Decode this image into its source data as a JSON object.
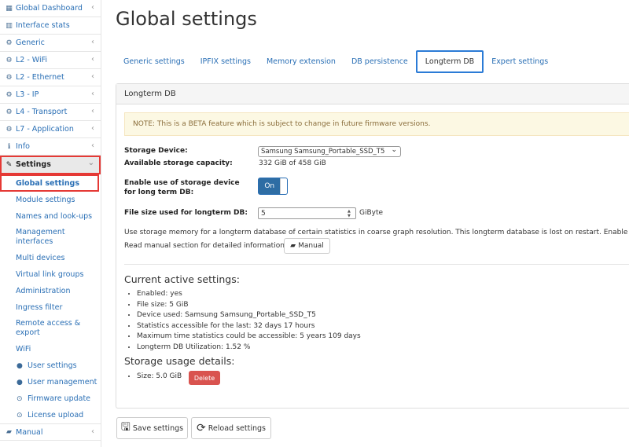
{
  "sidebar": {
    "items": [
      {
        "label": "Global Dashboard",
        "icon": "dashboard-icon",
        "chevron": "‹"
      },
      {
        "label": "Interface stats",
        "icon": "bar-chart-icon",
        "chevron": ""
      },
      {
        "label": "Generic",
        "icon": "gear-icon",
        "chevron": "‹"
      },
      {
        "label": "L2 - WiFi",
        "icon": "gear-icon",
        "chevron": "‹"
      },
      {
        "label": "L2 - Ethernet",
        "icon": "gear-icon",
        "chevron": "‹"
      },
      {
        "label": "L3 - IP",
        "icon": "gear-icon",
        "chevron": "‹"
      },
      {
        "label": "L4 - Transport",
        "icon": "gear-icon",
        "chevron": "‹"
      },
      {
        "label": "L7 - Application",
        "icon": "gear-icon",
        "chevron": "‹"
      },
      {
        "label": "Info",
        "icon": "info-icon",
        "chevron": "‹"
      }
    ],
    "settings": {
      "label": "Settings",
      "icon": "wrench-icon",
      "chevron": "⌄"
    },
    "subitems": [
      {
        "label": "Global settings"
      },
      {
        "label": "Module settings"
      },
      {
        "label": "Names and look-ups"
      },
      {
        "label": "Management interfaces"
      },
      {
        "label": "Multi devices"
      },
      {
        "label": "Virtual link groups"
      },
      {
        "label": "Administration"
      },
      {
        "label": "Ingress filter"
      },
      {
        "label": "Remote access & export"
      },
      {
        "label": "WiFi"
      },
      {
        "label": "User settings",
        "icon": "user-icon"
      },
      {
        "label": "User management",
        "icon": "users-icon"
      },
      {
        "label": "Firmware update",
        "icon": "firmware-icon"
      },
      {
        "label": "License upload",
        "icon": "license-icon"
      }
    ],
    "manual": {
      "label": "Manual",
      "icon": "book-icon",
      "chevron": "‹"
    }
  },
  "page": {
    "title": "Global settings"
  },
  "tabs": [
    {
      "label": "Generic settings"
    },
    {
      "label": "IPFIX settings"
    },
    {
      "label": "Memory extension"
    },
    {
      "label": "DB persistence"
    },
    {
      "label": "Longterm DB"
    },
    {
      "label": "Expert settings"
    }
  ],
  "panel": {
    "title": "Longterm DB",
    "note": "NOTE: This is a BETA feature which is subject to change in future firmware versions.",
    "storage_device_label": "Storage Device:",
    "storage_device_value": "Samsung Samsung_Portable_SSD_T5",
    "capacity_label": "Available storage capacity:",
    "capacity_value": "332 GiB of 458 GiB",
    "enable_label_1": "Enable use of storage device",
    "enable_label_2": "for long term DB:",
    "toggle_label": "On",
    "filesize_label": "File size used for longterm DB:",
    "filesize_value": "5",
    "filesize_unit": "GiByte",
    "description": "Use storage memory for a longterm database of certain statistics in coarse graph resolution. This longterm database is lost on restart. Enable the l",
    "manual_hint": "Read manual section for detailed information:",
    "manual_button": "Manual",
    "current_title": "Current active settings:",
    "current_items": [
      "Enabled: yes",
      "File size: 5 GiB",
      "Device used: Samsung Samsung_Portable_SSD_T5",
      "Statistics accessible for the last: 32 days 17 hours",
      "Maximum time statistics could be accessible: 5 years 109 days",
      "Longterm DB Utilization: 1.52 %"
    ],
    "usage_title": "Storage usage details:",
    "usage_size": "Size: 5.0 GiB",
    "delete_button": "Delete"
  },
  "footer": {
    "save_label": "Save settings",
    "reload_label": "Reload settings"
  },
  "colors": {
    "accent": "#2a6fb5",
    "danger": "#d9534f",
    "highlight": "#e53935",
    "warning_bg": "#fcf8e3"
  }
}
